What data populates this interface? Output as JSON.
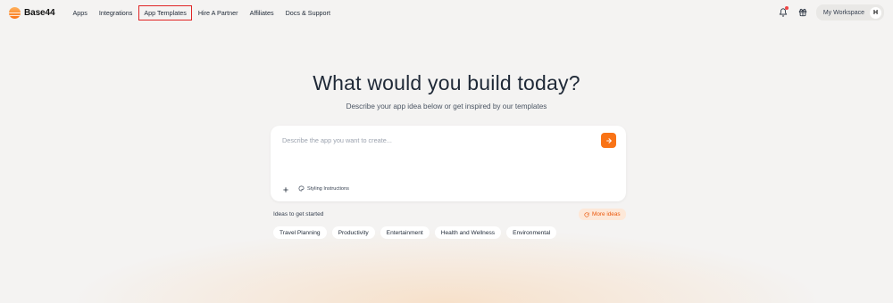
{
  "brand": {
    "name": "Base44"
  },
  "nav": {
    "links": [
      "Apps",
      "Integrations",
      "App Templates",
      "Hire A Partner",
      "Affiliates",
      "Docs & Support"
    ]
  },
  "header": {
    "workspace_label": "My Workspace",
    "avatar_initial": "H"
  },
  "hero": {
    "title": "What would you build today?",
    "subtitle": "Describe your app idea below or get inspired by our templates"
  },
  "prompt": {
    "placeholder": "Describe the app you want to create...",
    "value": "",
    "styling_label": "Styling Instructions"
  },
  "ideas": {
    "label": "Ideas to get started",
    "more_label": "More ideas",
    "chips": [
      "Travel Planning",
      "Productivity",
      "Entertainment",
      "Health and Wellness",
      "Environmental"
    ]
  },
  "colors": {
    "accent": "#f97316",
    "highlight_border": "#e02424",
    "notification_dot": "#ef4444"
  },
  "icons": [
    "logo-icon",
    "bell-icon",
    "gift-icon",
    "arrow-right-icon",
    "plus-icon",
    "palette-icon",
    "refresh-icon"
  ]
}
